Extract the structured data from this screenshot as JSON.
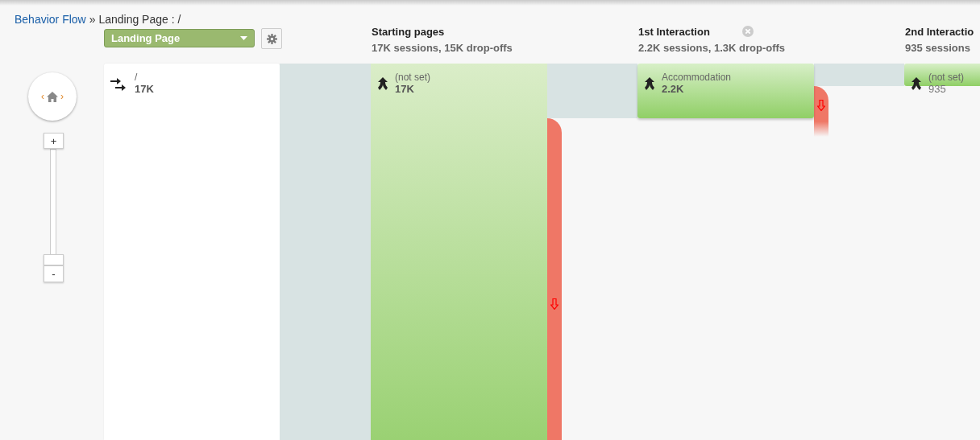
{
  "breadcrumb": {
    "link": "Behavior Flow",
    "separator": "»",
    "current": "Landing Page : /"
  },
  "dimension_dropdown": {
    "value": "Landing Page"
  },
  "navigator": {
    "previous": "‹",
    "next": "›"
  },
  "zoom": {
    "level": 0,
    "plus": "+",
    "minus": "-"
  },
  "landing_node": {
    "label": "/",
    "value": "17K"
  },
  "columns": [
    {
      "title": "Starting pages",
      "summary": "17K sessions, 15K drop-offs",
      "closable": false,
      "node": {
        "label": "(not set)",
        "value": "17K"
      }
    },
    {
      "title": "1st Interaction",
      "summary": "2.2K sessions, 1.3K drop-offs",
      "closable": true,
      "node": {
        "label": "Accommodation",
        "value": "2.2K"
      }
    },
    {
      "title": "2nd Interactio",
      "summary": "935 sessions",
      "closable": false,
      "node": {
        "label": "(not set)",
        "value": "935"
      }
    }
  ]
}
